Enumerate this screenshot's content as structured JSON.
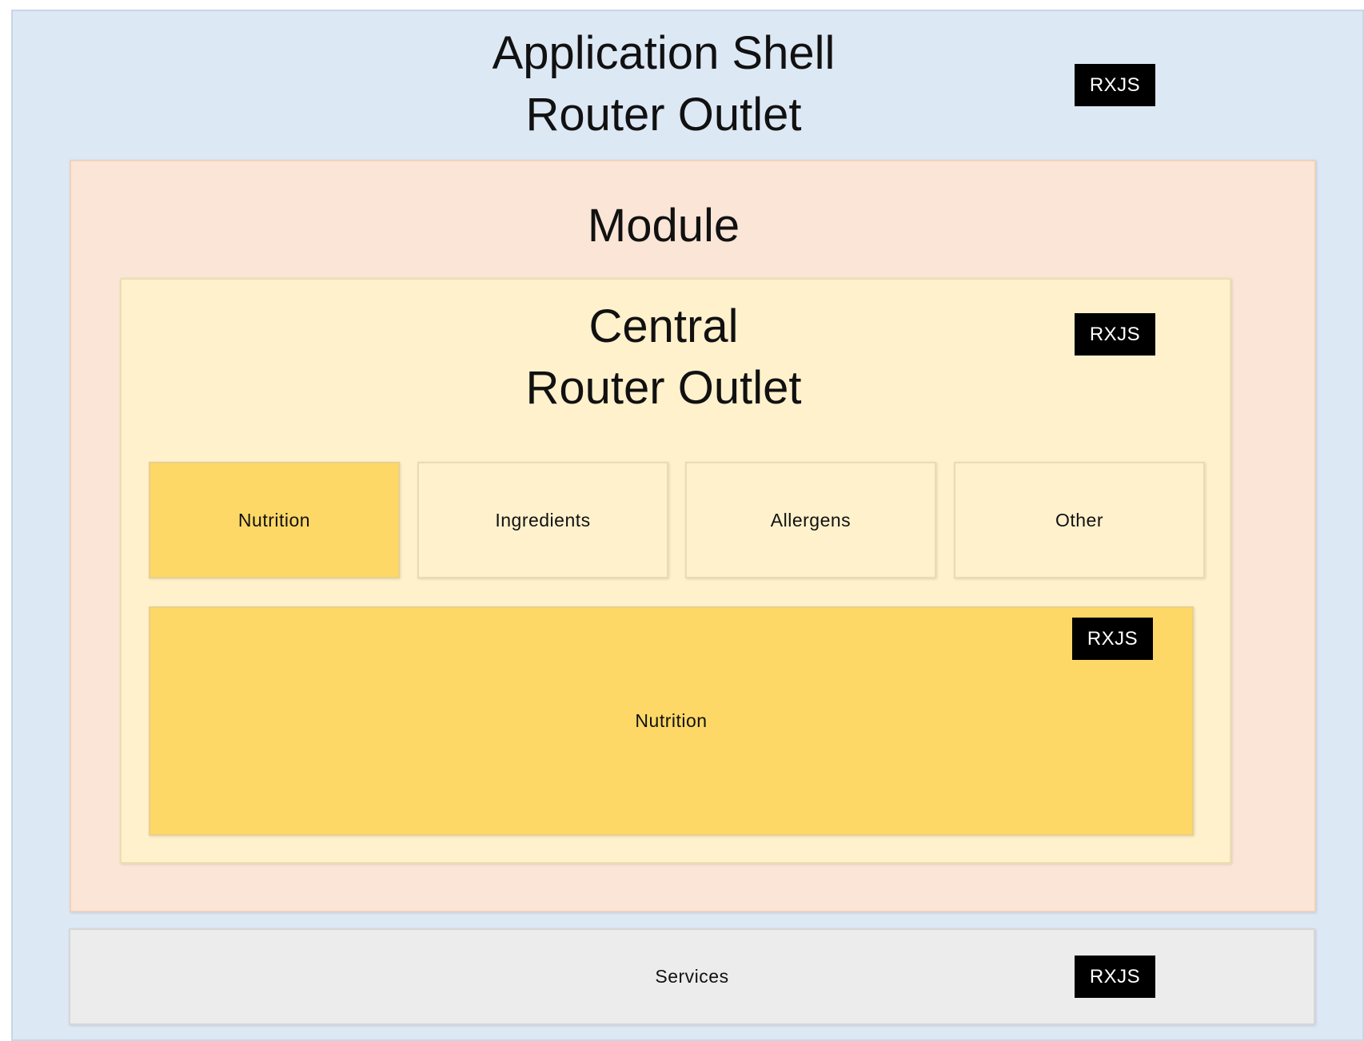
{
  "application_shell": {
    "title_line1": "Application Shell",
    "title_line2": "Router Outlet",
    "badge": "RXJS"
  },
  "module": {
    "title": "Module"
  },
  "central": {
    "title_line1": "Central",
    "title_line2": "Router Outlet",
    "badge": "RXJS"
  },
  "tabs": [
    {
      "label": "Nutrition",
      "active": true
    },
    {
      "label": "Ingredients",
      "active": false
    },
    {
      "label": "Allergens",
      "active": false
    },
    {
      "label": "Other",
      "active": false
    }
  ],
  "content_panel": {
    "label": "Nutrition",
    "badge": "RXJS"
  },
  "services": {
    "label": "Services",
    "badge": "RXJS"
  },
  "colors": {
    "shell_background": "#dde8f5",
    "module_background": "#fae5d6",
    "central_background": "#fef1cc",
    "active_tab": "#fdd866",
    "services_background": "#ececec",
    "badge_background": "#000000"
  }
}
